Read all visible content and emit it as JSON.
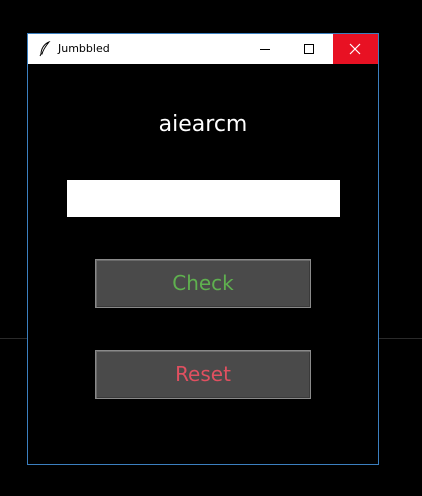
{
  "window": {
    "title": "Jumbbled"
  },
  "puzzle": {
    "scrambled_word": "aiearcm"
  },
  "answer": {
    "value": ""
  },
  "buttons": {
    "check_label": "Check",
    "reset_label": "Reset"
  },
  "icons": {
    "app": "feather-icon",
    "minimize": "minimize-icon",
    "maximize": "maximize-icon",
    "close": "close-icon"
  },
  "colors": {
    "background": "#000000",
    "titlebar": "#ffffff",
    "close_button": "#e81123",
    "button_face": "#4a4a4a",
    "check_text": "#5fb04f",
    "reset_text": "#e05060",
    "word_text": "#ffffff",
    "window_border": "#3b7fbf"
  }
}
